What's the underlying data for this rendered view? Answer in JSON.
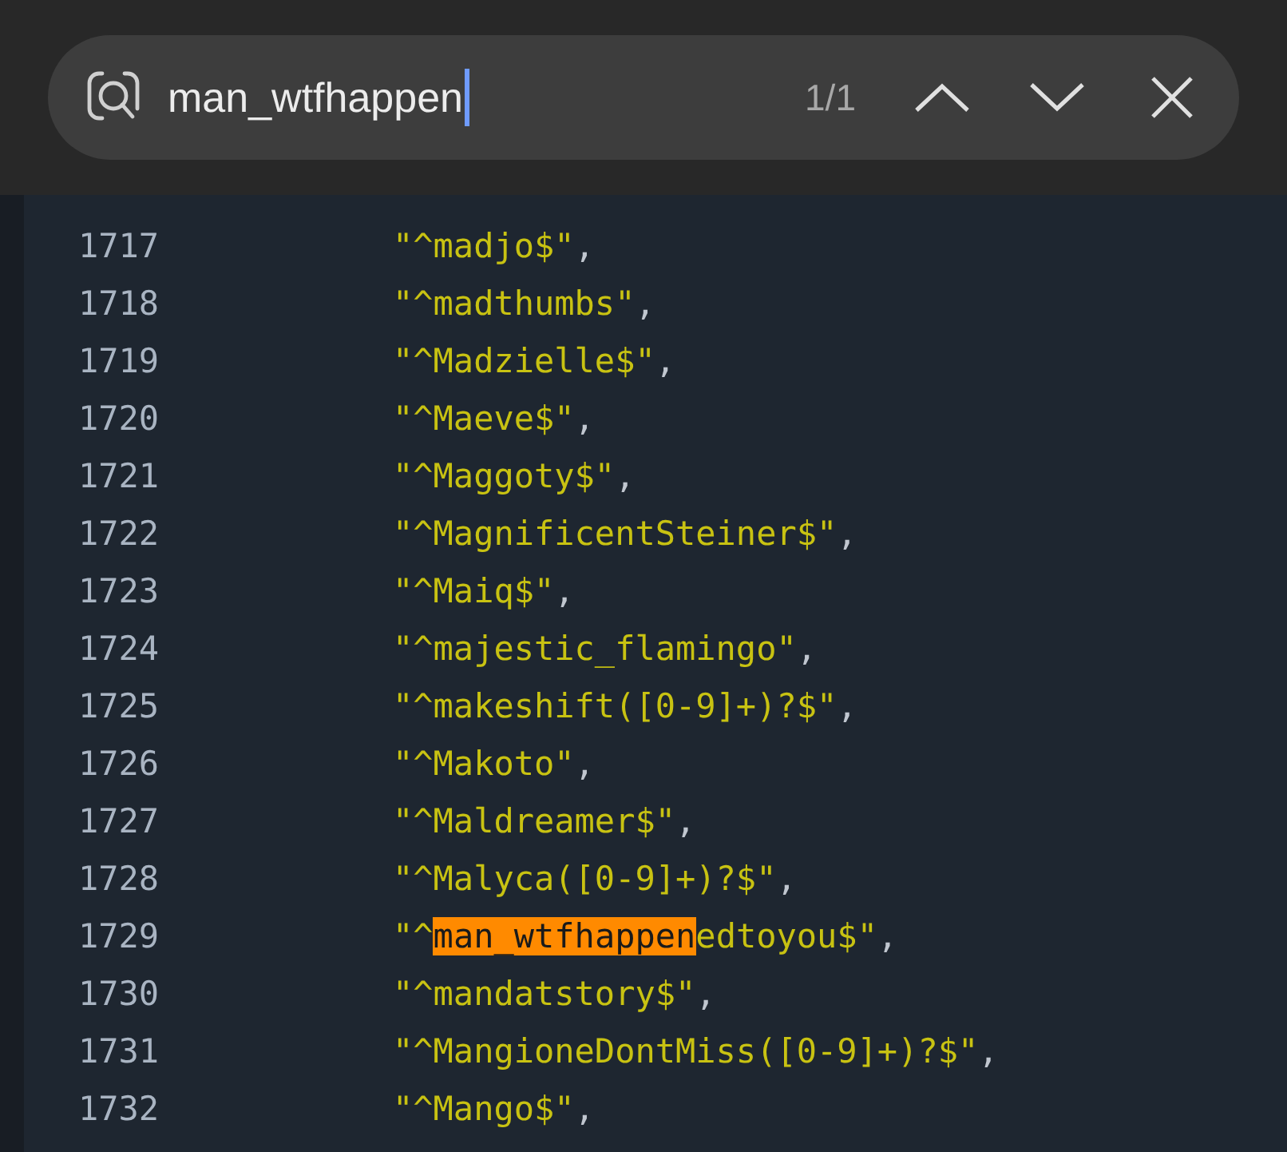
{
  "find_bar": {
    "query": "man_wtfhappen",
    "match_count": "1/1"
  },
  "lines": [
    {
      "number": "1717",
      "segments": [
        {
          "text": "\"^madjo$\"",
          "highlighted": false
        }
      ],
      "punct": ","
    },
    {
      "number": "1718",
      "segments": [
        {
          "text": "\"^madthumbs\"",
          "highlighted": false
        }
      ],
      "punct": ","
    },
    {
      "number": "1719",
      "segments": [
        {
          "text": "\"^Madzielle$\"",
          "highlighted": false
        }
      ],
      "punct": ","
    },
    {
      "number": "1720",
      "segments": [
        {
          "text": "\"^Maeve$\"",
          "highlighted": false
        }
      ],
      "punct": ","
    },
    {
      "number": "1721",
      "segments": [
        {
          "text": "\"^Maggoty$\"",
          "highlighted": false
        }
      ],
      "punct": ","
    },
    {
      "number": "1722",
      "segments": [
        {
          "text": "\"^MagnificentSteiner$\"",
          "highlighted": false
        }
      ],
      "punct": ","
    },
    {
      "number": "1723",
      "segments": [
        {
          "text": "\"^Maiq$\"",
          "highlighted": false
        }
      ],
      "punct": ","
    },
    {
      "number": "1724",
      "segments": [
        {
          "text": "\"^majestic_flamingo\"",
          "highlighted": false
        }
      ],
      "punct": ","
    },
    {
      "number": "1725",
      "segments": [
        {
          "text": "\"^makeshift([0-9]+)?$\"",
          "highlighted": false
        }
      ],
      "punct": ","
    },
    {
      "number": "1726",
      "segments": [
        {
          "text": "\"^Makoto\"",
          "highlighted": false
        }
      ],
      "punct": ","
    },
    {
      "number": "1727",
      "segments": [
        {
          "text": "\"^Maldreamer$\"",
          "highlighted": false
        }
      ],
      "punct": ","
    },
    {
      "number": "1728",
      "segments": [
        {
          "text": "\"^Malyca([0-9]+)?$\"",
          "highlighted": false
        }
      ],
      "punct": ","
    },
    {
      "number": "1729",
      "segments": [
        {
          "text": "\"^",
          "highlighted": false
        },
        {
          "text": "man_wtfhappen",
          "highlighted": true
        },
        {
          "text": "edtoyou$\"",
          "highlighted": false
        }
      ],
      "punct": ","
    },
    {
      "number": "1730",
      "segments": [
        {
          "text": "\"^mandatstory$\"",
          "highlighted": false
        }
      ],
      "punct": ","
    },
    {
      "number": "1731",
      "segments": [
        {
          "text": "\"^MangioneDontMiss([0-9]+)?$\"",
          "highlighted": false
        }
      ],
      "punct": ","
    },
    {
      "number": "1732",
      "segments": [
        {
          "text": "\"^Mango$\"",
          "highlighted": false
        }
      ],
      "punct": ","
    }
  ]
}
